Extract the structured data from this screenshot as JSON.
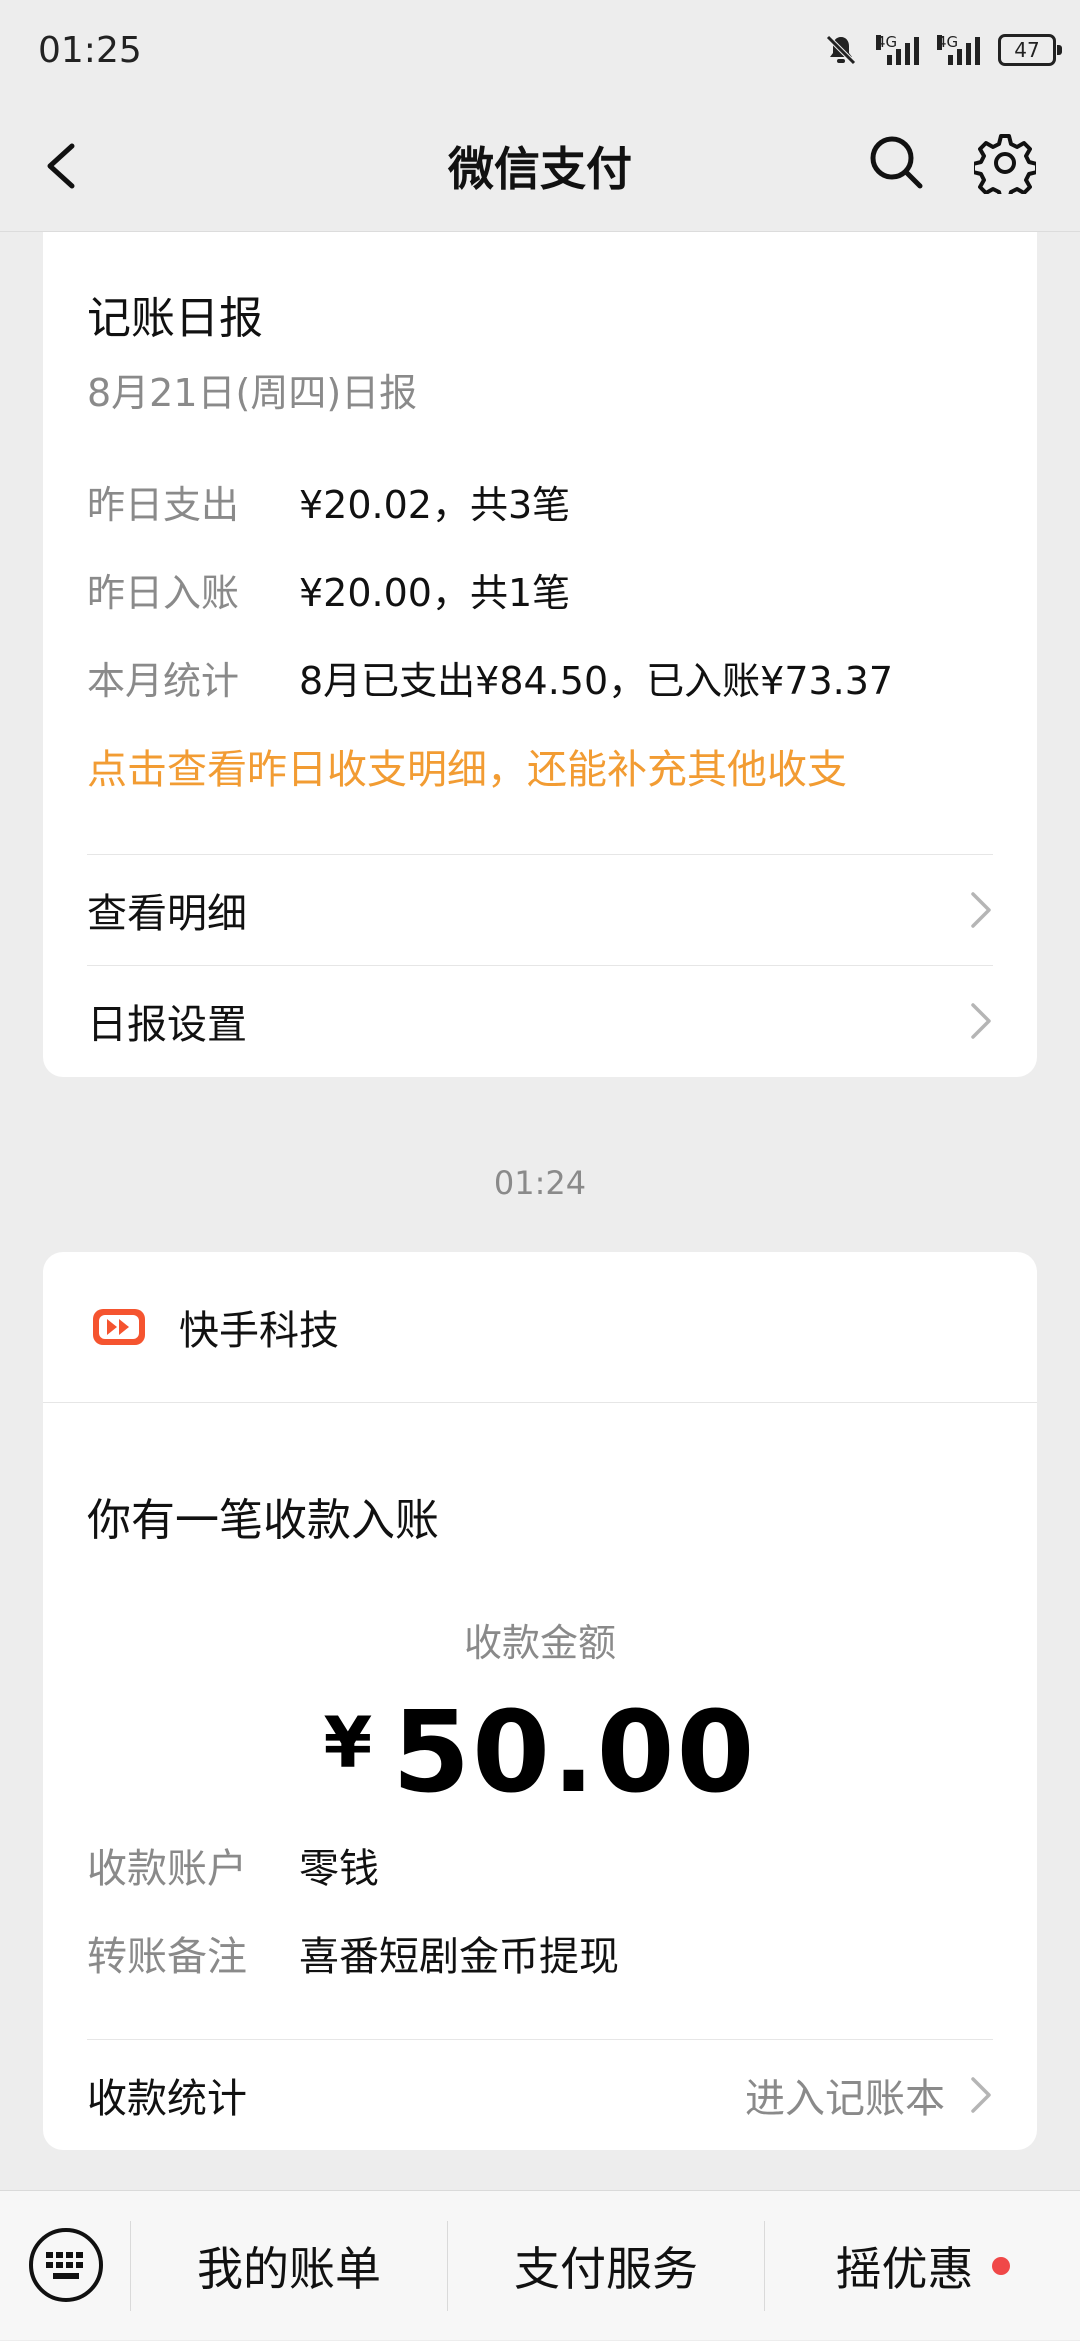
{
  "status_bar": {
    "time": "01:25",
    "network1": "4G",
    "network2": "4G",
    "battery": "47"
  },
  "nav": {
    "title": "微信支付"
  },
  "report": {
    "title": "记账日报",
    "subtitle": "8月21日(周四)日报",
    "rows": [
      {
        "key": "昨日支出",
        "value": "¥20.02，共3笔"
      },
      {
        "key": "昨日入账",
        "value": "¥20.00，共1笔"
      },
      {
        "key": "本月统计",
        "value": "8月已支出¥84.50，已入账¥73.37"
      }
    ],
    "link": "点击查看昨日收支明细，还能补充其他收支",
    "menu": [
      {
        "label": "查看明细"
      },
      {
        "label": "日报设置"
      }
    ]
  },
  "timestamp": "01:24",
  "payment": {
    "merchant": "快手科技",
    "heading": "你有一笔收款入账",
    "amount_label": "收款金额",
    "currency": "¥",
    "amount": "50.00",
    "rows": [
      {
        "key": "收款账户",
        "value": "零钱"
      },
      {
        "key": "转账备注",
        "value": "喜番短剧金币提现"
      }
    ],
    "stats_label": "收款统计",
    "stats_link": "进入记账本"
  },
  "bottom_bar": {
    "tabs": [
      {
        "label": "我的账单"
      },
      {
        "label": "支付服务"
      },
      {
        "label": "摇优惠"
      }
    ]
  },
  "colors": {
    "accent_orange": "#f29c33",
    "badge_red": "#f04848",
    "kuaishou_orange": "#f5542f"
  }
}
